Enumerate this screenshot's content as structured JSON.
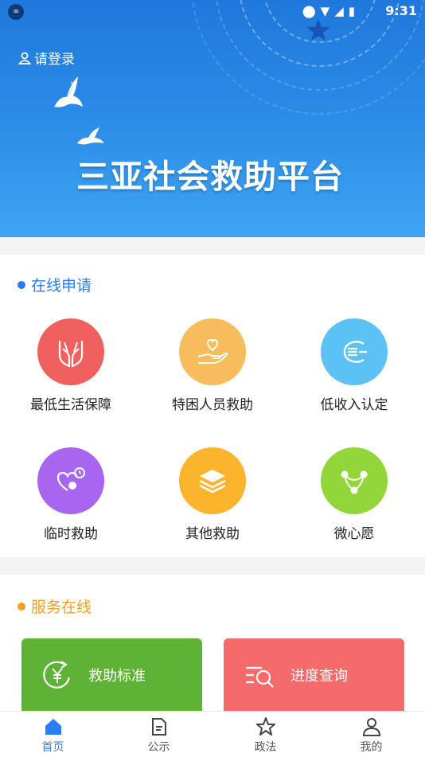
{
  "status_bar": {
    "time": "9:31",
    "left_icon": "infinity-badge-icon",
    "icons": [
      "location-icon",
      "wifi-icon",
      "signal-icon",
      "battery-icon"
    ]
  },
  "header": {
    "login_text": "请登录",
    "app_title": "三亚社会救助平台"
  },
  "online_apply": {
    "title": "在线申请",
    "accent": "#2a7ef5",
    "items": [
      {
        "label": "最低生活保障",
        "color": "#f0605f",
        "icon": "hands-icon"
      },
      {
        "label": "特困人员救助",
        "color": "#f7bd5d",
        "icon": "heart-hand-icon"
      },
      {
        "label": "低收入认定",
        "color": "#5cc2f5",
        "icon": "coins-icon"
      },
      {
        "label": "临时救助",
        "color": "#a765f0",
        "icon": "heart-clock-icon"
      },
      {
        "label": "其他救助",
        "color": "#fcb42c",
        "icon": "layers-icon"
      },
      {
        "label": "微心愿",
        "color": "#93d63a",
        "icon": "share-nodes-icon"
      }
    ]
  },
  "service_online": {
    "title": "服务在线",
    "accent": "#f5a020",
    "items": [
      {
        "label": "救助标准",
        "color": "#5eb236",
        "icon": "yuan-refresh-icon"
      },
      {
        "label": "进度查询",
        "color": "#f56b6b",
        "icon": "list-search-icon"
      }
    ]
  },
  "tabbar": {
    "items": [
      {
        "label": "首页",
        "icon": "home-icon",
        "active": true
      },
      {
        "label": "公示",
        "icon": "document-icon",
        "active": false
      },
      {
        "label": "政法",
        "icon": "star-icon",
        "active": false
      },
      {
        "label": "我的",
        "icon": "person-icon",
        "active": false
      }
    ]
  }
}
